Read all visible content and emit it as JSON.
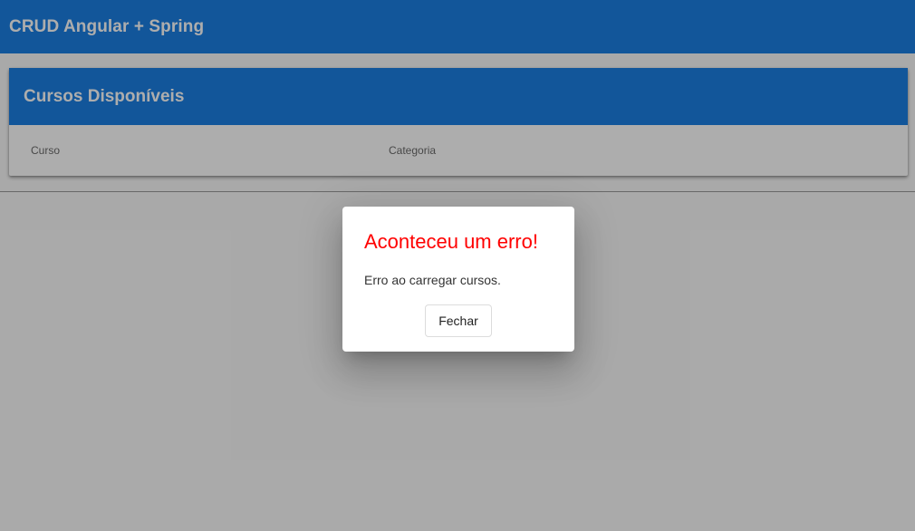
{
  "app": {
    "title": "CRUD Angular + Spring"
  },
  "card": {
    "title": "Cursos Disponíveis",
    "columns": [
      "Curso",
      "Categoria"
    ]
  },
  "dialog": {
    "title": "Aconteceu um erro!",
    "message": "Erro ao carregar cursos.",
    "close_label": "Fechar"
  },
  "colors": {
    "primary": "#1b7fe3",
    "error_title": "#ff0000",
    "backdrop": "rgba(0,0,0,0.32)"
  }
}
